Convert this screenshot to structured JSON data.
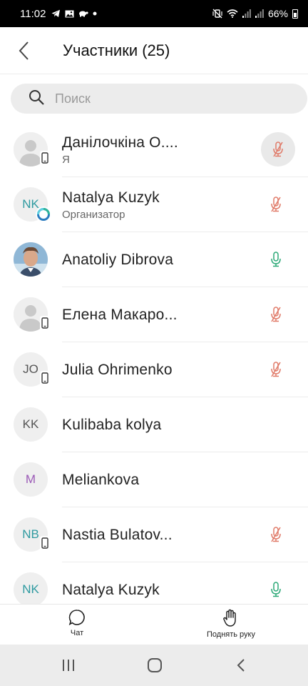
{
  "status_bar": {
    "time": "11:02",
    "left_icons": [
      "telegram-icon",
      "image-icon",
      "tortoise-icon",
      "dot-icon"
    ],
    "right_icons": [
      "mute-vibrate-icon",
      "wifi-icon",
      "signal-icon",
      "signal-icon",
      "battery-icon"
    ],
    "battery": "66%"
  },
  "header": {
    "title": "Участники (25)"
  },
  "search": {
    "placeholder": "Поиск",
    "value": ""
  },
  "colors": {
    "mic_muted": "#e07a68",
    "mic_on": "#2aa876",
    "initials_teal": "#2e9aa0",
    "initials_gray": "#555555",
    "initials_purple": "#9b59b6"
  },
  "participants": [
    {
      "name": "Данілочкіна О....",
      "role": "Я",
      "avatar": "person",
      "badge": "phone",
      "mic": "muted"
    },
    {
      "name": "Natalya Kuzyk",
      "role": "Организатор",
      "avatar": "initials",
      "initials": "NK",
      "badge": "ring",
      "mic": "muted"
    },
    {
      "name": "Anatoliy Dibrova",
      "role": "",
      "avatar": "photo",
      "badge": "",
      "mic": "on"
    },
    {
      "name": "Елена Макаро...",
      "role": "",
      "avatar": "person",
      "badge": "phone",
      "mic": "muted"
    },
    {
      "name": "Julia Ohrimenko",
      "role": "",
      "avatar": "initials",
      "initials": "JO",
      "badge": "phone",
      "mic": "muted"
    },
    {
      "name": "Kulibaba kolya",
      "role": "",
      "avatar": "initials",
      "initials": "KK",
      "badge": "",
      "mic": ""
    },
    {
      "name": "Meliankova",
      "role": "",
      "avatar": "initials",
      "initials": "M",
      "badge": "",
      "mic": ""
    },
    {
      "name": "Nastia Bulatov...",
      "role": "",
      "avatar": "initials",
      "initials": "NB",
      "badge": "phone",
      "mic": "muted"
    },
    {
      "name": "Natalya Kuzyk",
      "role": "",
      "avatar": "initials",
      "initials": "NK",
      "badge": "",
      "mic": "on"
    }
  ],
  "bottom_bar": {
    "chat_label": "Чат",
    "raise_hand_label": "Поднять руку"
  },
  "nav_bar": {
    "buttons": [
      "recent-apps-icon",
      "home-icon",
      "back-icon"
    ]
  }
}
